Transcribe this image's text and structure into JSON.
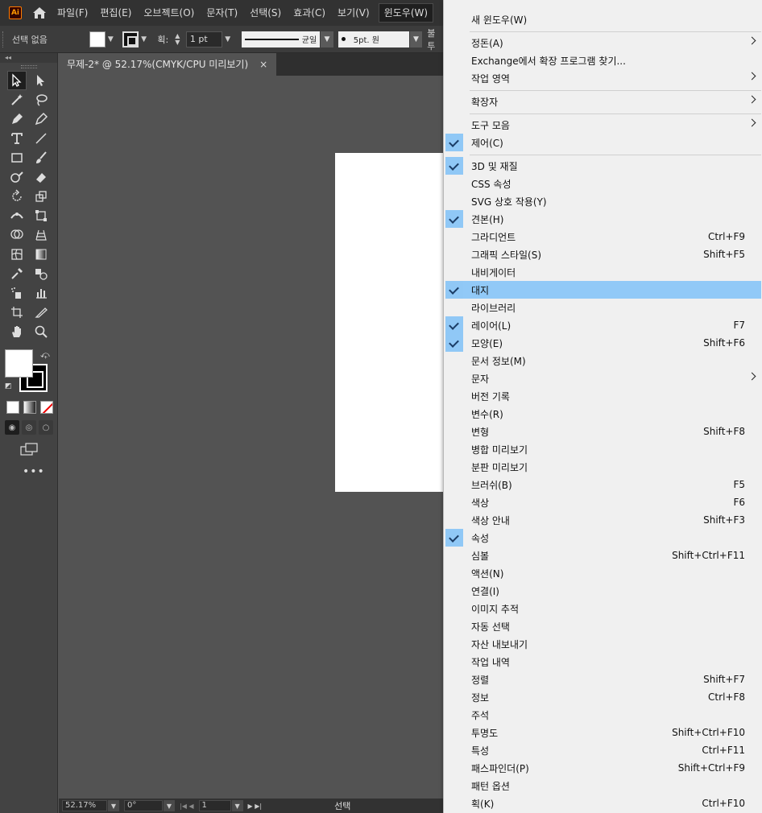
{
  "app": {
    "logo_text": "Ai"
  },
  "menubar": {
    "items": [
      "파일(F)",
      "편집(E)",
      "오브젝트(O)",
      "문자(T)",
      "선택(S)",
      "효과(C)",
      "보기(V)",
      "윈도우(W)"
    ]
  },
  "control": {
    "selection": "선택 없음",
    "stroke_label": "획:",
    "stroke_weight": "1 pt",
    "stroke_profile": "균일",
    "brush": "5pt. 원",
    "opacity_label": "불투"
  },
  "toolbar": {
    "header": "◂◂",
    "more": "•••"
  },
  "document": {
    "tab_title": "무제-2* @ 52.17%(CMYK/CPU 미리보기)",
    "close": "×"
  },
  "status": {
    "zoom": "52.17%",
    "rotation": "0°",
    "artboard": "1",
    "state": "선택"
  },
  "window_menu": {
    "items": [
      {
        "label": "새 윈도우(W)",
        "shortcut": "",
        "checked": false,
        "submenu": false
      },
      {
        "label": "정돈(A)",
        "shortcut": "",
        "checked": false,
        "submenu": true
      },
      {
        "label": "Exchange에서 확장 프로그램 찾기...",
        "shortcut": "",
        "checked": false,
        "submenu": false
      },
      {
        "label": "작업 영역",
        "shortcut": "",
        "checked": false,
        "submenu": true
      },
      {
        "label": "확장자",
        "shortcut": "",
        "checked": false,
        "submenu": true
      },
      {
        "label": "도구 모음",
        "shortcut": "",
        "checked": false,
        "submenu": true
      },
      {
        "label": "제어(C)",
        "shortcut": "",
        "checked": true,
        "submenu": false
      },
      {
        "label": "3D 및 재질",
        "shortcut": "",
        "checked": true,
        "submenu": false
      },
      {
        "label": "CSS 속성",
        "shortcut": "",
        "checked": false,
        "submenu": false
      },
      {
        "label": "SVG 상호 작용(Y)",
        "shortcut": "",
        "checked": false,
        "submenu": false
      },
      {
        "label": "견본(H)",
        "shortcut": "",
        "checked": true,
        "submenu": false
      },
      {
        "label": "그라디언트",
        "shortcut": "Ctrl+F9",
        "checked": false,
        "submenu": false
      },
      {
        "label": "그래픽 스타일(S)",
        "shortcut": "Shift+F5",
        "checked": false,
        "submenu": false
      },
      {
        "label": "내비게이터",
        "shortcut": "",
        "checked": false,
        "submenu": false
      },
      {
        "label": "대지",
        "shortcut": "",
        "checked": true,
        "submenu": false,
        "highlighted": true
      },
      {
        "label": "라이브러리",
        "shortcut": "",
        "checked": false,
        "submenu": false
      },
      {
        "label": "레이어(L)",
        "shortcut": "F7",
        "checked": true,
        "submenu": false
      },
      {
        "label": "모양(E)",
        "shortcut": "Shift+F6",
        "checked": true,
        "submenu": false
      },
      {
        "label": "문서 정보(M)",
        "shortcut": "",
        "checked": false,
        "submenu": false
      },
      {
        "label": "문자",
        "shortcut": "",
        "checked": false,
        "submenu": true
      },
      {
        "label": "버전 기록",
        "shortcut": "",
        "checked": false,
        "submenu": false
      },
      {
        "label": "변수(R)",
        "shortcut": "",
        "checked": false,
        "submenu": false
      },
      {
        "label": "변형",
        "shortcut": "Shift+F8",
        "checked": false,
        "submenu": false
      },
      {
        "label": "병합 미리보기",
        "shortcut": "",
        "checked": false,
        "submenu": false
      },
      {
        "label": "분판 미리보기",
        "shortcut": "",
        "checked": false,
        "submenu": false
      },
      {
        "label": "브러쉬(B)",
        "shortcut": "F5",
        "checked": false,
        "submenu": false
      },
      {
        "label": "색상",
        "shortcut": "F6",
        "checked": false,
        "submenu": false
      },
      {
        "label": "색상 안내",
        "shortcut": "Shift+F3",
        "checked": false,
        "submenu": false
      },
      {
        "label": "속성",
        "shortcut": "",
        "checked": true,
        "submenu": false
      },
      {
        "label": "심볼",
        "shortcut": "Shift+Ctrl+F11",
        "checked": false,
        "submenu": false
      },
      {
        "label": "액션(N)",
        "shortcut": "",
        "checked": false,
        "submenu": false
      },
      {
        "label": "연결(I)",
        "shortcut": "",
        "checked": false,
        "submenu": false
      },
      {
        "label": "이미지 추적",
        "shortcut": "",
        "checked": false,
        "submenu": false
      },
      {
        "label": "자동 선택",
        "shortcut": "",
        "checked": false,
        "submenu": false
      },
      {
        "label": "자산 내보내기",
        "shortcut": "",
        "checked": false,
        "submenu": false
      },
      {
        "label": "작업 내역",
        "shortcut": "",
        "checked": false,
        "submenu": false
      },
      {
        "label": "정렬",
        "shortcut": "Shift+F7",
        "checked": false,
        "submenu": false
      },
      {
        "label": "정보",
        "shortcut": "Ctrl+F8",
        "checked": false,
        "submenu": false
      },
      {
        "label": "주석",
        "shortcut": "",
        "checked": false,
        "submenu": false
      },
      {
        "label": "투명도",
        "shortcut": "Shift+Ctrl+F10",
        "checked": false,
        "submenu": false
      },
      {
        "label": "특성",
        "shortcut": "Ctrl+F11",
        "checked": false,
        "submenu": false
      },
      {
        "label": "패스파인더(P)",
        "shortcut": "Shift+Ctrl+F9",
        "checked": false,
        "submenu": false
      },
      {
        "label": "패턴 옵션",
        "shortcut": "",
        "checked": false,
        "submenu": false
      },
      {
        "label": "획(K)",
        "shortcut": "Ctrl+F10",
        "checked": false,
        "submenu": false
      }
    ]
  }
}
